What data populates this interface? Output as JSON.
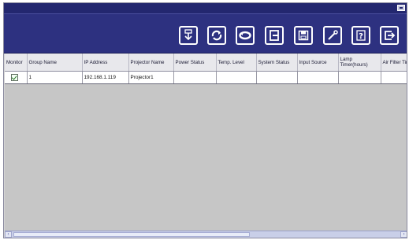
{
  "window": {
    "title": ""
  },
  "toolbar": {
    "buttons": [
      {
        "name": "refresh-down-icon"
      },
      {
        "name": "reload-icon"
      },
      {
        "name": "sync-icon"
      },
      {
        "name": "input-icon"
      },
      {
        "name": "save-icon"
      },
      {
        "name": "tools-icon"
      },
      {
        "name": "help-icon",
        "glyph": "?"
      },
      {
        "name": "exit-icon"
      }
    ]
  },
  "table": {
    "columns": [
      "Monitor",
      "Group Name",
      "IP Address",
      "Projector Name",
      "Power Status",
      "Temp. Level",
      "System Status",
      "Input Source",
      "Lamp Timer(hours)",
      "Air Filter Timer (hours)"
    ],
    "rows": [
      {
        "monitor": true,
        "group": "1",
        "ip": "192.168.1.119",
        "projector": "Projector1",
        "power": "",
        "temp": "",
        "system": "",
        "input": "",
        "lamp": "",
        "filter": ""
      }
    ]
  },
  "colors": {
    "titlebar": "#23276f",
    "toolbar": "#2d3180",
    "grid_bg": "#c6c6c6"
  }
}
